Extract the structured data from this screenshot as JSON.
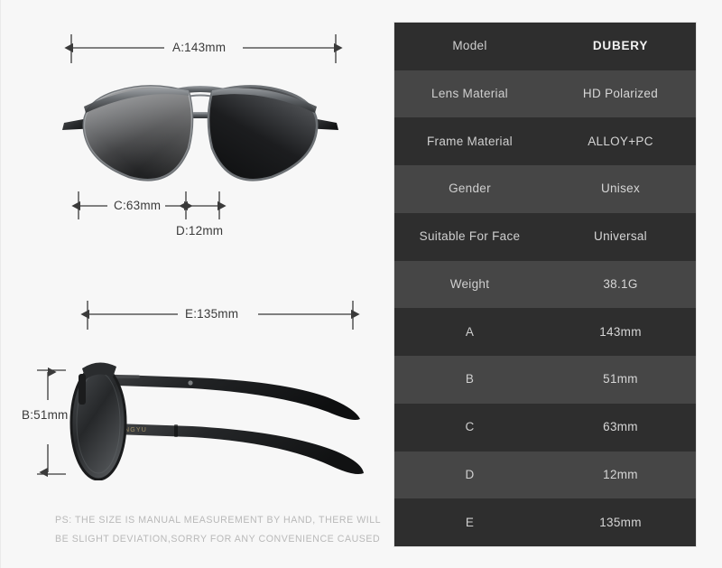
{
  "product": {
    "brand_on_temple": "XINGYU",
    "front_view_alt": "aviator-sunglasses-front-view",
    "side_view_alt": "aviator-sunglasses-side-view"
  },
  "dimensions": {
    "a": "A:143mm",
    "b": "B:51mm",
    "c": "C:63mm",
    "d": "D:12mm",
    "e": "E:135mm"
  },
  "note": {
    "line1": "PS: THE SIZE IS MANUAL MEASUREMENT BY HAND, THERE WILL",
    "line2": "BE SLIGHT DEVIATION,SORRY FOR ANY CONVENIENCE CAUSED"
  },
  "spec_table": {
    "rows": [
      {
        "label": "Model",
        "value": "DUBERY"
      },
      {
        "label": "Lens Material",
        "value": "HD Polarized"
      },
      {
        "label": "Frame Material",
        "value": "ALLOY+PC"
      },
      {
        "label": "Gender",
        "value": "Unisex"
      },
      {
        "label": "Suitable For Face",
        "value": "Universal"
      },
      {
        "label": "Weight",
        "value": "38.1G"
      },
      {
        "label": "A",
        "value": "143mm"
      },
      {
        "label": "B",
        "value": "51mm"
      },
      {
        "label": "C",
        "value": "63mm"
      },
      {
        "label": "D",
        "value": "12mm"
      },
      {
        "label": "E",
        "value": "135mm"
      }
    ]
  },
  "colors": {
    "page_background": "#f7f7f7",
    "row_dark": "#2e2e2e",
    "row_light": "#464646",
    "row_text": "#cfcfcf",
    "dimension_line": "#3a3a3a",
    "note_text": "#b9b9b9"
  }
}
